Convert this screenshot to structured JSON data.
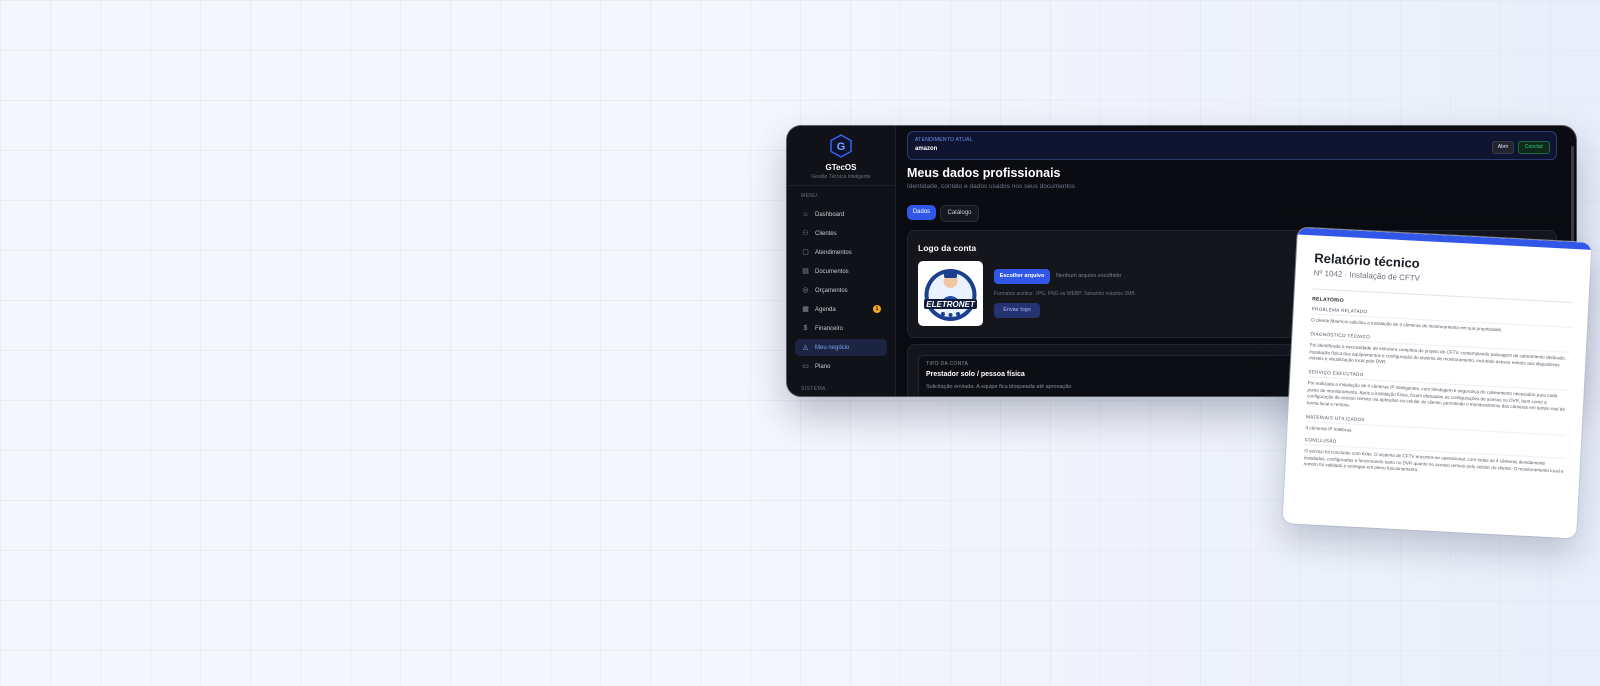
{
  "sidebar": {
    "brand": "GTecOS",
    "tagline": "Gestão Técnica Inteligente",
    "menu_section": "MENU",
    "system_section": "SISTEMA",
    "items": [
      {
        "label": "Dashboard",
        "icon": "home-icon"
      },
      {
        "label": "Clientes",
        "icon": "users-icon"
      },
      {
        "label": "Atendimentos",
        "icon": "clipboard-icon"
      },
      {
        "label": "Documentos",
        "icon": "document-icon"
      },
      {
        "label": "Orçamentos",
        "icon": "dollar-icon"
      },
      {
        "label": "Agenda",
        "icon": "calendar-icon",
        "badge": "1"
      },
      {
        "label": "Financeiro",
        "icon": "currency-icon"
      },
      {
        "label": "Meu negócio",
        "icon": "bell-icon",
        "active": true
      },
      {
        "label": "Plano",
        "icon": "card-icon"
      }
    ]
  },
  "banner": {
    "label": "ATENDIMENTO ATUAL",
    "value": "amazon",
    "open_label": "Abrir",
    "finish_label": "Concluir"
  },
  "page": {
    "title": "Meus dados profissionais",
    "subtitle": "Identidade, contato e dados usados nos seus documentos",
    "tabs": [
      {
        "label": "Dados",
        "active": true
      },
      {
        "label": "Catálogo",
        "active": false
      }
    ]
  },
  "logo_card": {
    "title": "Logo da conta",
    "logo_text": "ELETRONET",
    "choose_file": "Escolher arquivo",
    "no_file": "Nenhum arquivo escolhido",
    "formats": "Formatos aceitos: JPG, PNG ou WEBP. Tamanho máximo 2MB.",
    "send": "Enviar logo"
  },
  "account": {
    "label": "TIPO DA CONTA",
    "value": "Prestador solo / pessoa física",
    "note": "Solicitação enviada. A equipe fica bloqueada até aprovação."
  },
  "report": {
    "title": "Relatório técnico",
    "subtitle": "Nº 1042 · Instalação de CFTV",
    "section": "RELATÓRIO",
    "blocks": [
      {
        "heading": "PROBLEMA RELATADO",
        "text": "O cliente Maurício solicitou a instalação de 4 câmeras de monitoramento em sua propriedade."
      },
      {
        "heading": "DIAGNÓSTICO TÉCNICO",
        "text": "Foi identificada a necessidade de estrutura completa do projeto de CFTV, contemplando passagem de cabeamento dedicado, instalação física dos equipamentos e configuração do sistema de monitoramento, incluindo acesso remoto aos dispositivos móveis e visualização local pelo DVR."
      },
      {
        "heading": "SERVIÇO EXECUTADO",
        "text": "Foi realizada a instalação de 4 câmeras IP inteligentes, com blindagem e segurança do cabeamento necessário para cada ponto de monitoramento. Após a instalação física, foram efetuadas as configurações de acesso no DVR, bem como a configuração de acesso remoto via aplicativo no celular do cliente, permitindo o monitoramento das câmeras em tempo real de forma local e remota."
      },
      {
        "heading": "MATERIAIS UTILIZADOS",
        "text": "4 câmeras IP Intelbras."
      },
      {
        "heading": "CONCLUSÃO",
        "text": "O serviço foi concluído com êxito. O sistema de CFTV encontra-se operacional, com todas as 4 câmeras devidamente instaladas, configuradas e funcionando tanto no DVR quanto no acesso remoto pelo celular do cliente. O monitoramento local e remoto foi validado e entregue em pleno funcionamento."
      }
    ]
  },
  "colors": {
    "accent": "#3157e8",
    "badge": "#f5a524",
    "success": "#35d07f"
  }
}
